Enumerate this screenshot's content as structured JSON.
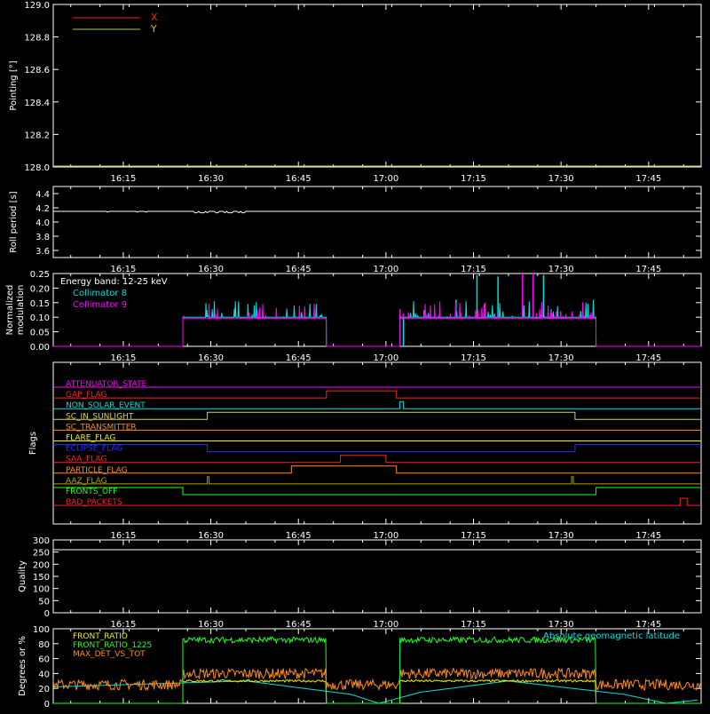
{
  "time_ticks": [
    "16:15",
    "16:30",
    "16:45",
    "17:00",
    "17:15",
    "17:30",
    "17:45"
  ],
  "colors": {
    "background": "#000000",
    "axes": "#ffffff",
    "red": "#ff2020",
    "yellow": "#d8d050",
    "cyan": "#00e0e0",
    "magenta": "#ff00ff",
    "orange": "#ff8c1a",
    "green": "#20ff20",
    "blue": "#2030ff",
    "olive": "#b0a000",
    "flag_label": "#c0c000"
  },
  "chart_data": [
    {
      "type": "line",
      "panel": "pointing",
      "ylabel": "Pointing [°]",
      "ylim": [
        128.0,
        129.0
      ],
      "yticks": [
        "128.0",
        "128.2",
        "128.4",
        "128.6",
        "128.8",
        "129.0"
      ],
      "legend_placement": "top-left",
      "series": [
        {
          "name": "X",
          "color": "#ff2020",
          "values": []
        },
        {
          "name": "Y",
          "color": "#c8c050",
          "values": []
        }
      ]
    },
    {
      "type": "line",
      "panel": "roll",
      "ylabel": "Roll period [s]",
      "ylim": [
        3.5,
        4.5
      ],
      "yticks": [
        "3.6",
        "3.8",
        "4.0",
        "4.2",
        "4.4"
      ],
      "series": [
        {
          "name": "",
          "color": "#ffffff",
          "values": [
            [
              16.05,
              4.15
            ],
            [
              17.9,
              4.15
            ]
          ]
        }
      ]
    },
    {
      "type": "line",
      "panel": "modulation",
      "ylabel": "Normalized modulation",
      "ylim": [
        0.0,
        0.25
      ],
      "yticks": [
        "0.00",
        "0.05",
        "0.10",
        "0.15",
        "0.20",
        "0.25"
      ],
      "annotation": "Energy band: 12-25 keV",
      "series": [
        {
          "name": "Collimator 8",
          "color": "#00e0e0",
          "segments": [
            [
              16.42,
              16.83
            ],
            [
              17.04,
              17.6
            ]
          ],
          "base": 0.1,
          "peaks": [
            [
              17.26,
              0.245
            ],
            [
              17.32,
              0.24
            ],
            [
              17.45,
              0.245
            ],
            [
              17.2,
              0.16
            ],
            [
              17.05,
              0.0
            ]
          ]
        },
        {
          "name": "Collimator 9",
          "color": "#ff00ff",
          "segments": [
            [
              16.42,
              16.83
            ],
            [
              17.04,
              17.6
            ]
          ],
          "base": 0.095,
          "peaks": [
            [
              17.39,
              0.25
            ],
            [
              17.42,
              0.25
            ]
          ]
        }
      ]
    },
    {
      "type": "line",
      "panel": "flags",
      "ylabel": "Flags",
      "series": [
        {
          "name": "ATTENUATOR_STATE",
          "color": "#ff00ff",
          "levels": [
            [
              16.05,
              0
            ],
            [
              17.9,
              0
            ]
          ]
        },
        {
          "name": "GAP_FLAG",
          "color": "#ff2020",
          "levels": [
            [
              16.05,
              0
            ],
            [
              16.83,
              1
            ],
            [
              17.03,
              0
            ],
            [
              17.9,
              0
            ]
          ]
        },
        {
          "name": "NON_SOLAR_EVENT",
          "color": "#00e0e0",
          "levels": [
            [
              16.05,
              0
            ],
            [
              17.04,
              1
            ],
            [
              17.05,
              0
            ],
            [
              17.9,
              0
            ]
          ]
        },
        {
          "name": "SC_IN_SUNLIGHT",
          "color": "#d8d050",
          "levels": [
            [
              16.05,
              0
            ],
            [
              16.49,
              1
            ],
            [
              17.54,
              0
            ],
            [
              17.9,
              0
            ]
          ]
        },
        {
          "name": "SC_TRANSMITTER",
          "color": "#ff8c1a",
          "levels": [
            [
              16.05,
              0
            ],
            [
              17.9,
              0
            ]
          ]
        },
        {
          "name": "FLARE_FLAG",
          "color": "#f0f000",
          "levels": [
            [
              16.05,
              0
            ],
            [
              17.9,
              0
            ]
          ]
        },
        {
          "name": "ECLIPSE_FLAG",
          "color": "#2030ff",
          "levels": [
            [
              16.05,
              1
            ],
            [
              16.49,
              0
            ],
            [
              17.54,
              1
            ],
            [
              17.9,
              1
            ]
          ]
        },
        {
          "name": "SAA_FLAG",
          "color": "#ff2020",
          "levels": [
            [
              16.05,
              0
            ],
            [
              16.87,
              1
            ],
            [
              17.0,
              0
            ],
            [
              17.9,
              0
            ]
          ]
        },
        {
          "name": "PARTICLE_FLAG",
          "color": "#ff8c1a",
          "levels": [
            [
              16.05,
              0
            ],
            [
              16.73,
              1
            ],
            [
              17.03,
              0
            ],
            [
              17.9,
              0
            ]
          ]
        },
        {
          "name": "AAZ_FLAG",
          "color": "#b0a000",
          "levels": [
            [
              16.05,
              0
            ],
            [
              16.49,
              1
            ],
            [
              16.495,
              0
            ],
            [
              17.53,
              1
            ],
            [
              17.535,
              0
            ],
            [
              17.9,
              0
            ]
          ]
        },
        {
          "name": "FRONTS_OFF",
          "color": "#20ff20",
          "levels": [
            [
              16.05,
              1
            ],
            [
              16.42,
              0
            ],
            [
              17.6,
              1
            ],
            [
              17.9,
              1
            ]
          ]
        },
        {
          "name": "BAD_PACKETS",
          "color": "#ff2020",
          "levels": [
            [
              16.05,
              0
            ],
            [
              17.84,
              1
            ],
            [
              17.86,
              0
            ],
            [
              17.9,
              0
            ]
          ]
        }
      ]
    },
    {
      "type": "line",
      "panel": "quality",
      "ylabel": "Quality",
      "ylim": [
        0,
        300
      ],
      "yticks": [
        "0",
        "50",
        "100",
        "150",
        "200",
        "250",
        "300"
      ],
      "series": []
    },
    {
      "type": "line",
      "panel": "ratios",
      "ylabel": "Degrees or %",
      "ylim": [
        0,
        100
      ],
      "yticks": [
        "0",
        "20",
        "40",
        "60",
        "80",
        "100"
      ],
      "series": [
        {
          "name": "FRONT_RATIO",
          "color": "#f0f000",
          "segments": [
            [
              16.42,
              16.83
            ],
            [
              17.04,
              17.6
            ]
          ],
          "base": 30
        },
        {
          "name": "FRONT_RATIO_1225",
          "color": "#20ff20",
          "segments": [
            [
              16.42,
              16.83
            ],
            [
              17.04,
              17.6
            ]
          ],
          "base": 85
        },
        {
          "name": "MAX_DET_VS_TOT",
          "color": "#ff8c1a",
          "base_in": 40,
          "base_out": 25
        },
        {
          "name": "Absolute geomagnetic latitude",
          "color": "#00e0e0",
          "curve": [
            [
              16.05,
              22
            ],
            [
              16.25,
              25
            ],
            [
              16.6,
              30
            ],
            [
              16.9,
              12
            ],
            [
              16.98,
              0
            ],
            [
              17.1,
              15
            ],
            [
              17.35,
              30
            ],
            [
              17.68,
              12
            ],
            [
              17.8,
              0
            ],
            [
              17.9,
              5
            ]
          ]
        }
      ]
    }
  ]
}
